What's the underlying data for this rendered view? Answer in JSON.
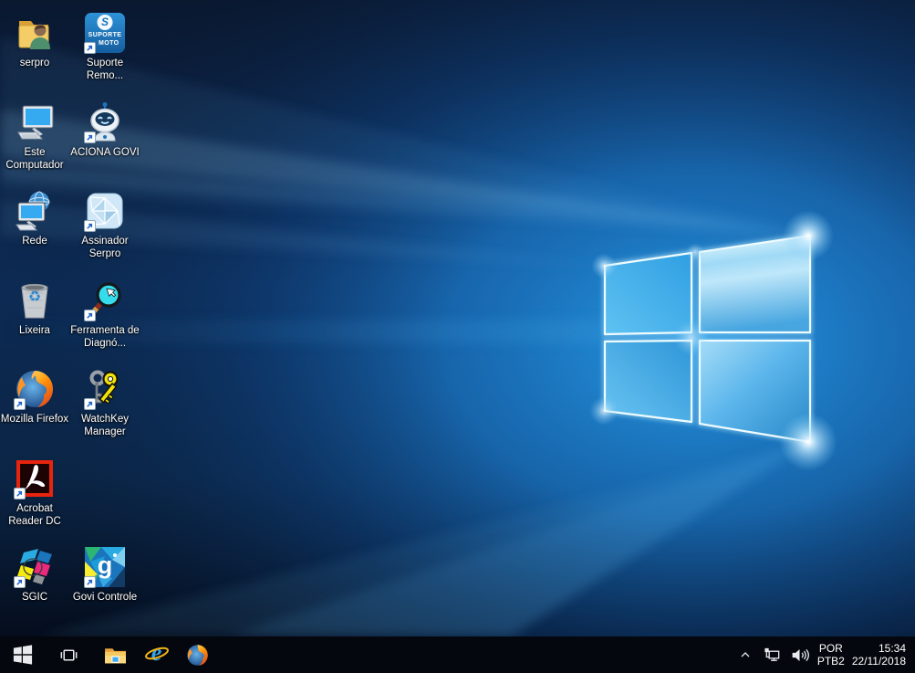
{
  "desktop": {
    "icons": [
      {
        "id": "serpro",
        "label": "serpro",
        "icon": "user-folder-icon",
        "shortcut": false
      },
      {
        "id": "suporte-remoto",
        "label": "Suporte Remo...",
        "icon": "suporte-remoto-tile-icon",
        "shortcut": true,
        "tile": {
          "letter": "S",
          "line1": "SUPORTE",
          "line2": "MOTO"
        }
      },
      {
        "id": "este-computador",
        "label": "Este Computador",
        "icon": "computer-icon",
        "shortcut": false
      },
      {
        "id": "aciona-govi",
        "label": "ACIONA GOVI",
        "icon": "robot-icon",
        "shortcut": true
      },
      {
        "id": "rede",
        "label": "Rede",
        "icon": "network-globe-icon",
        "shortcut": false
      },
      {
        "id": "assinador-serpro",
        "label": "Assinador Serpro",
        "icon": "diamond-icon",
        "shortcut": true
      },
      {
        "id": "lixeira",
        "label": "Lixeira",
        "icon": "recycle-bin-icon",
        "shortcut": false,
        "glyph": "♻"
      },
      {
        "id": "ferramenta-diagnostico",
        "label": "Ferramenta de Diagnó...",
        "icon": "magnifier-icon",
        "shortcut": true
      },
      {
        "id": "mozilla-firefox",
        "label": "Mozilla Firefox",
        "icon": "firefox-icon",
        "shortcut": true
      },
      {
        "id": "watchkey-manager",
        "label": "WatchKey Manager",
        "icon": "keys-icon",
        "shortcut": true
      },
      {
        "id": "acrobat-reader",
        "label": "Acrobat Reader DC",
        "icon": "acrobat-icon",
        "shortcut": true
      },
      {
        "id": "sgic",
        "label": "SGIC",
        "icon": "sgic-icon",
        "shortcut": true
      },
      {
        "id": "govi-controle",
        "label": "Govi Controle",
        "icon": "govi-tile-icon",
        "shortcut": true,
        "tile": {
          "letter": "g"
        }
      }
    ]
  },
  "taskbar": {
    "buttons": [
      {
        "id": "start",
        "icon": "windows-logo-icon"
      },
      {
        "id": "task-view",
        "icon": "task-view-icon"
      },
      {
        "id": "file-explorer",
        "icon": "folder-icon"
      },
      {
        "id": "internet-explorer",
        "icon": "ie-icon",
        "letter": "e"
      },
      {
        "id": "firefox",
        "icon": "firefox-icon"
      }
    ],
    "tray": {
      "overflow_chevron_icon": "chevron-up-icon",
      "network_icon": "network-ethernet-icon",
      "volume_icon": "speaker-icon",
      "language": {
        "line1": "POR",
        "line2": "PTB2"
      },
      "clock": {
        "time": "15:34",
        "date": "22/11/2018"
      }
    }
  },
  "colors": {
    "taskbar_bg": "#04070d",
    "wallpaper_base": "#081830",
    "wallpaper_accent": "#2b9fe4",
    "icon_label": "#ffffff",
    "tray_text": "#ffffff"
  }
}
